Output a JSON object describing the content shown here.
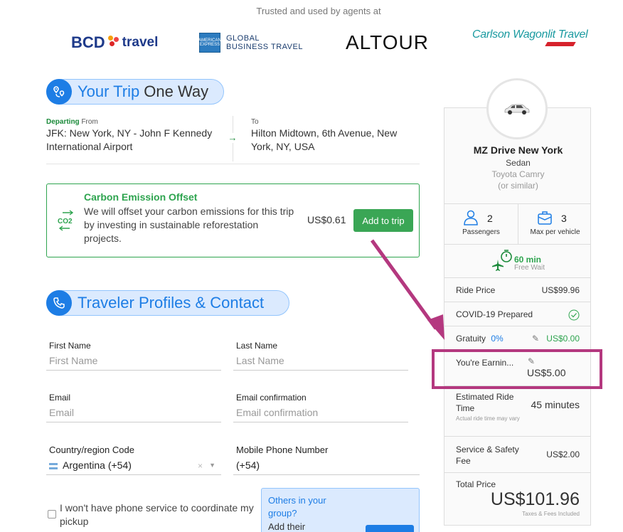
{
  "header": {
    "trusted_text": "Trusted and used by agents at",
    "logos": {
      "bcd_main": "BCD",
      "bcd_sub": "travel",
      "amex_line1": "GLOBAL",
      "amex_line2": "BUSINESS TRAVEL",
      "amex_badge": "AMERICAN EXPRESS",
      "altour": "ALTOUR",
      "carlson": "Carlson Wagonlit Travel"
    }
  },
  "trip": {
    "title_main": "Your Trip",
    "title_sub": "One Way",
    "departing_label": "Departing",
    "from_label": "From",
    "from_value": "JFK: New York, NY - John F Kennedy International Airport",
    "to_label": "To",
    "to_value": "Hilton Midtown, 6th Avenue, New York, NY, USA"
  },
  "carbon": {
    "title": "Carbon Emission Offset",
    "icon_text": "CO2",
    "description": "We will offset your carbon emissions for this trip by investing in sustainable reforestation projects.",
    "price": "US$0.61",
    "button": "Add to trip"
  },
  "traveler": {
    "title": "Traveler Profiles & Contact",
    "first_name_label": "First Name",
    "first_name_placeholder": "First Name",
    "last_name_label": "Last Name",
    "last_name_placeholder": "Last Name",
    "email_label": "Email",
    "email_placeholder": "Email",
    "email_confirm_label": "Email confirmation",
    "email_confirm_placeholder": "Email confirmation",
    "country_label": "Country/region Code",
    "country_value": "Argentina (+54)",
    "phone_label": "Mobile Phone Number",
    "phone_value": "(+54)",
    "no_phone_text": "I won't have phone service to coordinate my pickup",
    "others_title": "Others in your group?",
    "others_sub": "Add their"
  },
  "vehicle": {
    "company": "MZ Drive New York",
    "class": "Sedan",
    "model": "Toyota Camry",
    "similar": "(or similar)",
    "passengers_count": "2",
    "passengers_label": "Passengers",
    "bags_count": "3",
    "bags_label": "Max per vehicle",
    "wait_time": "60 min",
    "wait_label": "Free Wait"
  },
  "pricing": {
    "ride_price_label": "Ride Price",
    "ride_price_value": "US$99.96",
    "covid_label": "COVID-19 Prepared",
    "gratuity_label": "Gratuity",
    "gratuity_pct": "0%",
    "gratuity_value": "US$0.00",
    "earning_label": "You're Earnin...",
    "earning_value": "US$5.00",
    "est_time_label": "Estimated Ride Time",
    "est_time_note": "Actual ride time may vary",
    "est_time_value": "45 minutes",
    "fee_label": "Service & Safety Fee",
    "fee_value": "US$2.00",
    "total_label": "Total Price",
    "total_value": "US$101.96",
    "total_note": "Taxes & Fees Included"
  },
  "colors": {
    "accent": "#1d7de5",
    "green": "#2ea44f",
    "highlight": "#b4387f"
  }
}
